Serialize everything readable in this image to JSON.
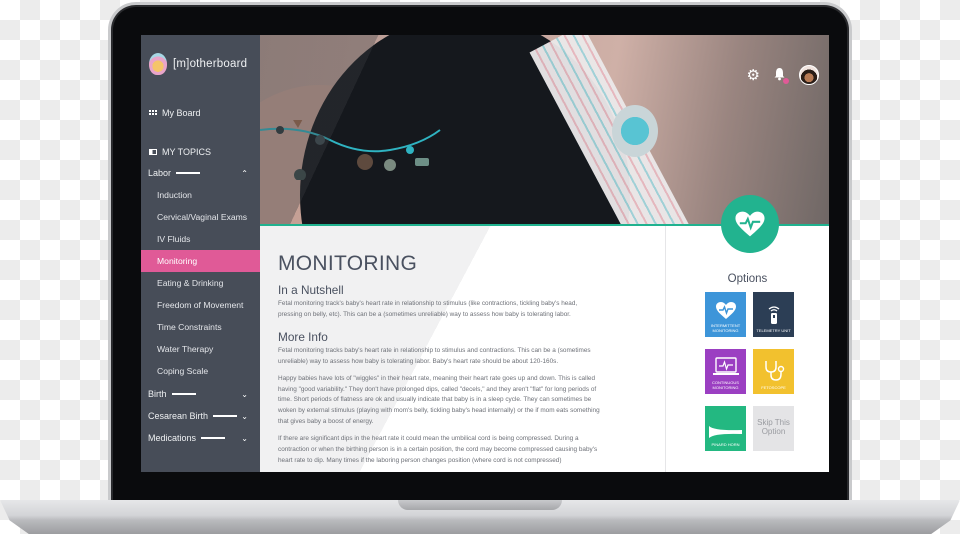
{
  "app": {
    "brand_name": "[m]otherboard"
  },
  "sidebar": {
    "my_board_label": "My Board",
    "my_topics_label": "MY TOPICS",
    "sections": [
      {
        "label": "Labor",
        "expanded": true,
        "items": [
          {
            "label": "Induction",
            "active": false
          },
          {
            "label": "Cervical/Vaginal Exams",
            "active": false
          },
          {
            "label": "IV Fluids",
            "active": false
          },
          {
            "label": "Monitoring",
            "active": true
          },
          {
            "label": "Eating & Drinking",
            "active": false
          },
          {
            "label": "Freedom of Movement",
            "active": false
          },
          {
            "label": "Time Constraints",
            "active": false
          },
          {
            "label": "Water Therapy",
            "active": false
          },
          {
            "label": "Coping Scale",
            "active": false
          }
        ]
      },
      {
        "label": "Birth",
        "expanded": false
      },
      {
        "label": "Cesarean Birth",
        "expanded": false
      },
      {
        "label": "Medications",
        "expanded": false
      }
    ]
  },
  "header": {
    "icons": [
      "gear-icon",
      "bell-icon",
      "avatar"
    ],
    "notification_badge": true
  },
  "article": {
    "title": "MONITORING",
    "sections": [
      {
        "heading": "In a Nutshell",
        "paragraphs": [
          "Fetal monitoring track's baby's heart rate in relationship to stimulus (like contractions, tickling baby's head, pressing on belly, etc).  This can be a (sometimes unreliable) way to assess how baby is tolerating labor."
        ]
      },
      {
        "heading": "More Info",
        "paragraphs": [
          "Fetal monitoring tracks baby's heart rate in relationship to stimulus and contractions.  This can be a (sometimes unreliable) way to assess how baby is tolerating labor.  Baby's heart rate should be about 120-160s.",
          "Happy babies have lots of \"wiggles\" in their heart rate, meaning their heart rate goes up and down.  This is called having \"good variability.\"  They don't have prolonged dips, called \"decels,\" and they aren't \"flat\" for long periods of time.  Short periods of flatness are ok and usually indicate that baby is in a sleep cycle.  They can sometimes be woken by external stimulus (playing with mom's belly, tickling baby's head internally) or the if mom eats something that gives baby a boost of energy.",
          "If there are significant dips in the heart rate it could mean the umbilical cord is being compressed.  During a contraction or when the birthing person is in a certain position, the cord may become compressed causing baby's heart rate to dip.  Many times if the laboring person changes position (where cord is not compressed)"
        ]
      }
    ]
  },
  "options": {
    "title": "Options",
    "tiles": [
      {
        "label": "Intermittent Monitoring",
        "icon": "heart-pulse-icon",
        "color": "#3d95d9"
      },
      {
        "label": "Telemetry Unit",
        "icon": "telemetry-icon",
        "color": "#2c3e55"
      },
      {
        "label": "Continuous Monitoring",
        "icon": "laptop-pulse-icon",
        "color": "#9b3fc2"
      },
      {
        "label": "Fetoscope",
        "icon": "stethoscope-icon",
        "color": "#f2c12e"
      },
      {
        "label": "Pinard Horn",
        "icon": "pinard-horn-icon",
        "color": "#23b881"
      },
      {
        "label": "Skip This Option",
        "icon": "skip-icon",
        "color": "#e4e4e6"
      }
    ]
  },
  "colors": {
    "accent_pink": "#e05a97",
    "accent_teal": "#22b38f",
    "sidebar_bg": "#474d58"
  }
}
